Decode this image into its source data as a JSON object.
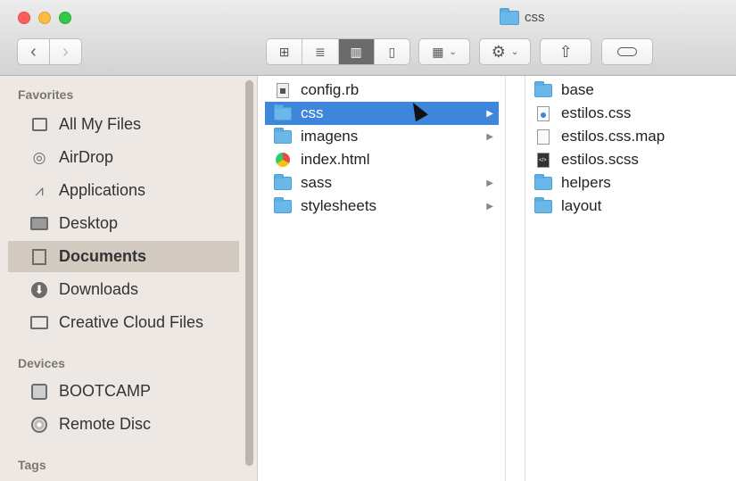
{
  "window": {
    "title": "css"
  },
  "toolbar": {
    "back_label": "‹",
    "forward_label": "›",
    "views": [
      "⊞",
      "≣",
      "▥",
      "▯"
    ],
    "arrange_icon": "▦",
    "action_icon": "⚙",
    "share_icon": "⇧",
    "chevron": "⌄"
  },
  "sidebar": {
    "sections": {
      "favorites": "Favorites",
      "devices": "Devices",
      "tags": "Tags"
    },
    "favorites": [
      {
        "label": "All My Files",
        "icon": "all-files-icon"
      },
      {
        "label": "AirDrop",
        "icon": "airdrop-icon"
      },
      {
        "label": "Applications",
        "icon": "applications-icon"
      },
      {
        "label": "Desktop",
        "icon": "desktop-icon"
      },
      {
        "label": "Documents",
        "icon": "documents-icon",
        "selected": true
      },
      {
        "label": "Downloads",
        "icon": "downloads-icon"
      },
      {
        "label": "Creative Cloud Files",
        "icon": "folder-icon"
      }
    ],
    "devices": [
      {
        "label": "BOOTCAMP",
        "icon": "hard-drive-icon"
      },
      {
        "label": "Remote Disc",
        "icon": "disc-icon"
      }
    ],
    "glyphs": {
      "airdrop": "◎",
      "applications": "⩘",
      "downloads": "⬇"
    }
  },
  "column1": [
    {
      "name": "config.rb",
      "type": "ruby-file"
    },
    {
      "name": "css",
      "type": "folder",
      "selected": true
    },
    {
      "name": "imagens",
      "type": "folder"
    },
    {
      "name": "index.html",
      "type": "html-file"
    },
    {
      "name": "sass",
      "type": "folder"
    },
    {
      "name": "stylesheets",
      "type": "folder"
    }
  ],
  "column3": [
    {
      "name": "base",
      "type": "folder"
    },
    {
      "name": "estilos.css",
      "type": "css-file"
    },
    {
      "name": "estilos.css.map",
      "type": "file"
    },
    {
      "name": "estilos.scss",
      "type": "scss-file"
    },
    {
      "name": "helpers",
      "type": "folder"
    },
    {
      "name": "layout",
      "type": "folder"
    }
  ],
  "chevron_right": "▶",
  "colors": {
    "selection": "#3d86dc",
    "sidebar_selected": "#d2c9c1",
    "folder": "#6ab8ea"
  }
}
